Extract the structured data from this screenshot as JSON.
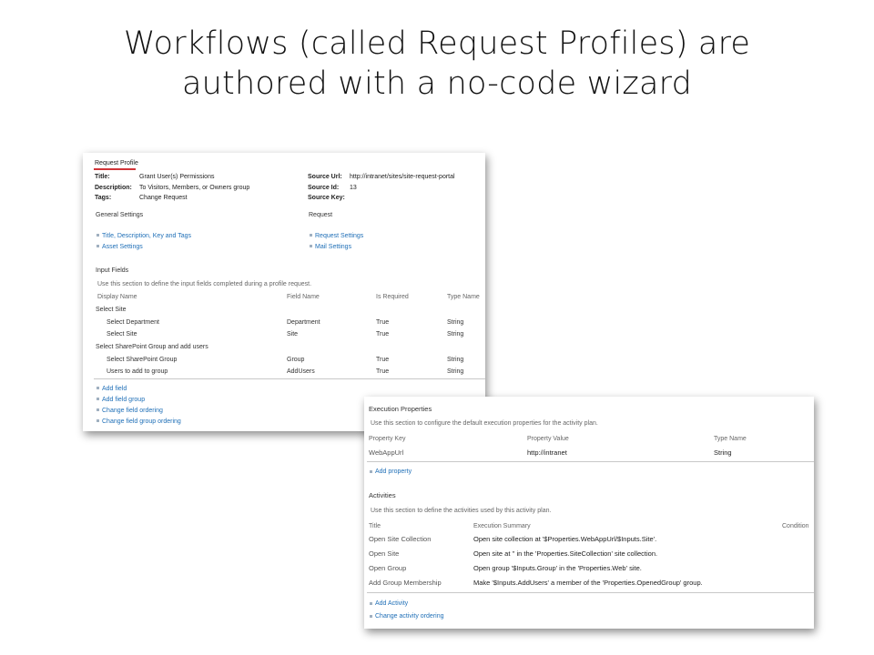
{
  "slide": {
    "title_line1": "Workflows (called Request Profiles) are",
    "title_line2": "authored with a no-code wizard"
  },
  "profile": {
    "heading": "Request Profile",
    "fields": {
      "title_label": "Title:",
      "title_value": "Grant User(s) Permissions",
      "description_label": "Description:",
      "description_value": "To Visitors, Members, or Owners group",
      "tags_label": "Tags:",
      "tags_value": "Change Request",
      "source_url_label": "Source Url:",
      "source_url_value": "http://intranet/sites/site-request-portal",
      "source_id_label": "Source Id:",
      "source_id_value": "13",
      "source_key_label": "Source Key:"
    },
    "general_settings": {
      "heading": "General Settings",
      "links": [
        "Title, Description, Key and Tags",
        "Asset Settings"
      ]
    },
    "request": {
      "heading": "Request",
      "links": [
        "Request Settings",
        "Mail Settings"
      ]
    },
    "input_fields": {
      "heading": "Input Fields",
      "description": "Use this section to define the input fields completed during a profile request.",
      "columns": [
        "Display Name",
        "Field Name",
        "Is Required",
        "Type Name"
      ],
      "groups": [
        {
          "name": "Select Site",
          "rows": [
            [
              "Select Department",
              "Department",
              "True",
              "String"
            ],
            [
              "Select Site",
              "Site",
              "True",
              "String"
            ]
          ]
        },
        {
          "name": "Select SharePoint Group and add users",
          "rows": [
            [
              "Select SharePoint Group",
              "Group",
              "True",
              "String"
            ],
            [
              "Users to add to group",
              "AddUsers",
              "True",
              "String"
            ]
          ]
        }
      ],
      "actions": [
        "Add field",
        "Add field group",
        "Change field ordering",
        "Change field group ordering"
      ]
    }
  },
  "execution": {
    "heading": "Execution Properties",
    "description": "Use this section to configure the default execution properties for the activity plan.",
    "columns": [
      "Property Key",
      "Property Value",
      "Type Name"
    ],
    "rows": [
      [
        "WebAppUrl",
        "http://intranet",
        "String"
      ]
    ],
    "add_property": "Add property"
  },
  "activities": {
    "heading": "Activities",
    "description": "Use this section to define the activities used by this activity plan.",
    "columns": [
      "Title",
      "Execution Summary",
      "Condition"
    ],
    "rows": [
      [
        "Open Site Collection",
        "Open site collection at '$Properties.WebAppUrl/$Inputs.Site'."
      ],
      [
        "Open Site",
        "Open site at '' in the 'Properties.SiteCollection' site collection."
      ],
      [
        "Open Group",
        "Open group '$Inputs.Group' in the 'Properties.Web' site."
      ],
      [
        "Add Group Membership",
        "Make '$Inputs.AddUsers' a member of the 'Properties.OpenedGroup' group."
      ]
    ],
    "actions": [
      "Add Activity",
      "Change activity ordering"
    ]
  }
}
